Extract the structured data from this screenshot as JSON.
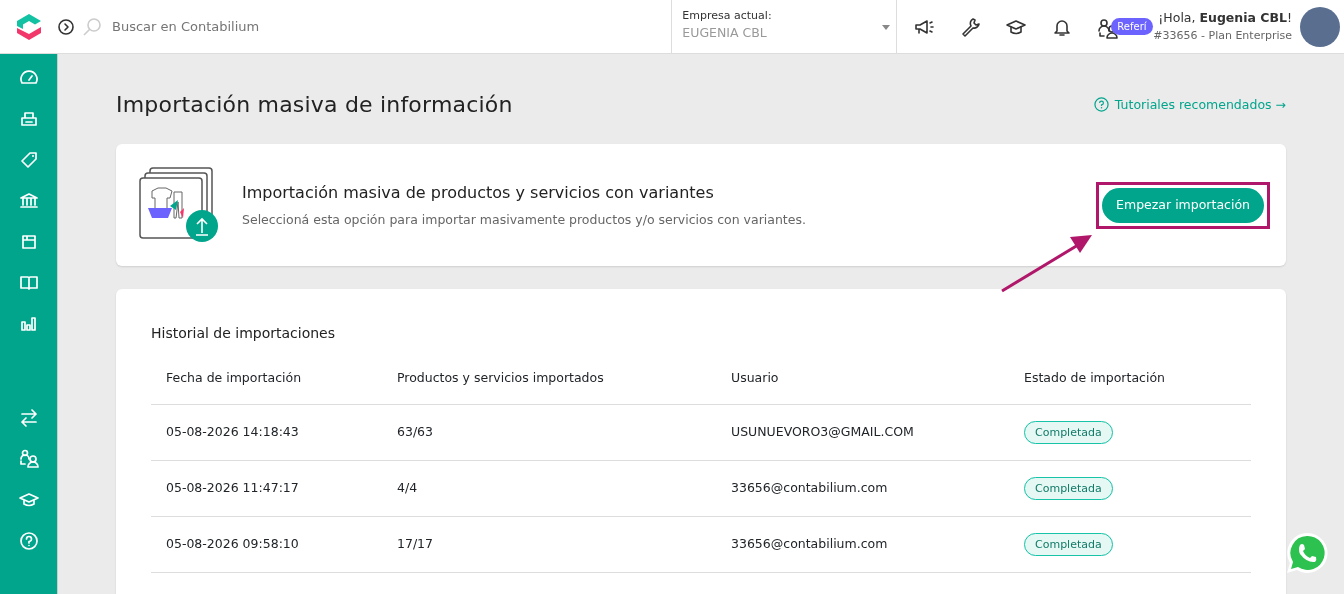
{
  "topbar": {
    "search": {
      "placeholder": "Buscar en Contabilium"
    },
    "company": {
      "label": "Empresa actual:",
      "value": "EUGENIA CBL"
    },
    "referral_badge": "Referí",
    "greeting": {
      "prefix": "¡Hola, ",
      "name": "Eugenia CBL",
      "suffix": "!"
    },
    "plan": "#33656 - Plan Enterprise"
  },
  "page": {
    "title": "Importación masiva de información",
    "tutorials_link": "Tutoriales recomendados →"
  },
  "import_card": {
    "title": "Importación masiva de productos y servicios con variantes",
    "description": "Seleccioná esta opción para importar masivamente productos y/o servicios con variantes.",
    "button": "Empezar importación"
  },
  "history": {
    "title": "Historial de importaciones",
    "columns": [
      "Fecha de importación",
      "Productos y servicios importados",
      "Usuario",
      "Estado de importación"
    ],
    "rows": [
      {
        "date": "05-08-2026 14:18:43",
        "count": "63/63",
        "user": "USUNUEVORO3@GMAIL.COM",
        "status": "Completada"
      },
      {
        "date": "05-08-2026 11:47:17",
        "count": "4/4",
        "user": "33656@contabilium.com",
        "status": "Completada"
      },
      {
        "date": "05-08-2026 09:58:10",
        "count": "17/17",
        "user": "33656@contabilium.com",
        "status": "Completada"
      }
    ]
  }
}
